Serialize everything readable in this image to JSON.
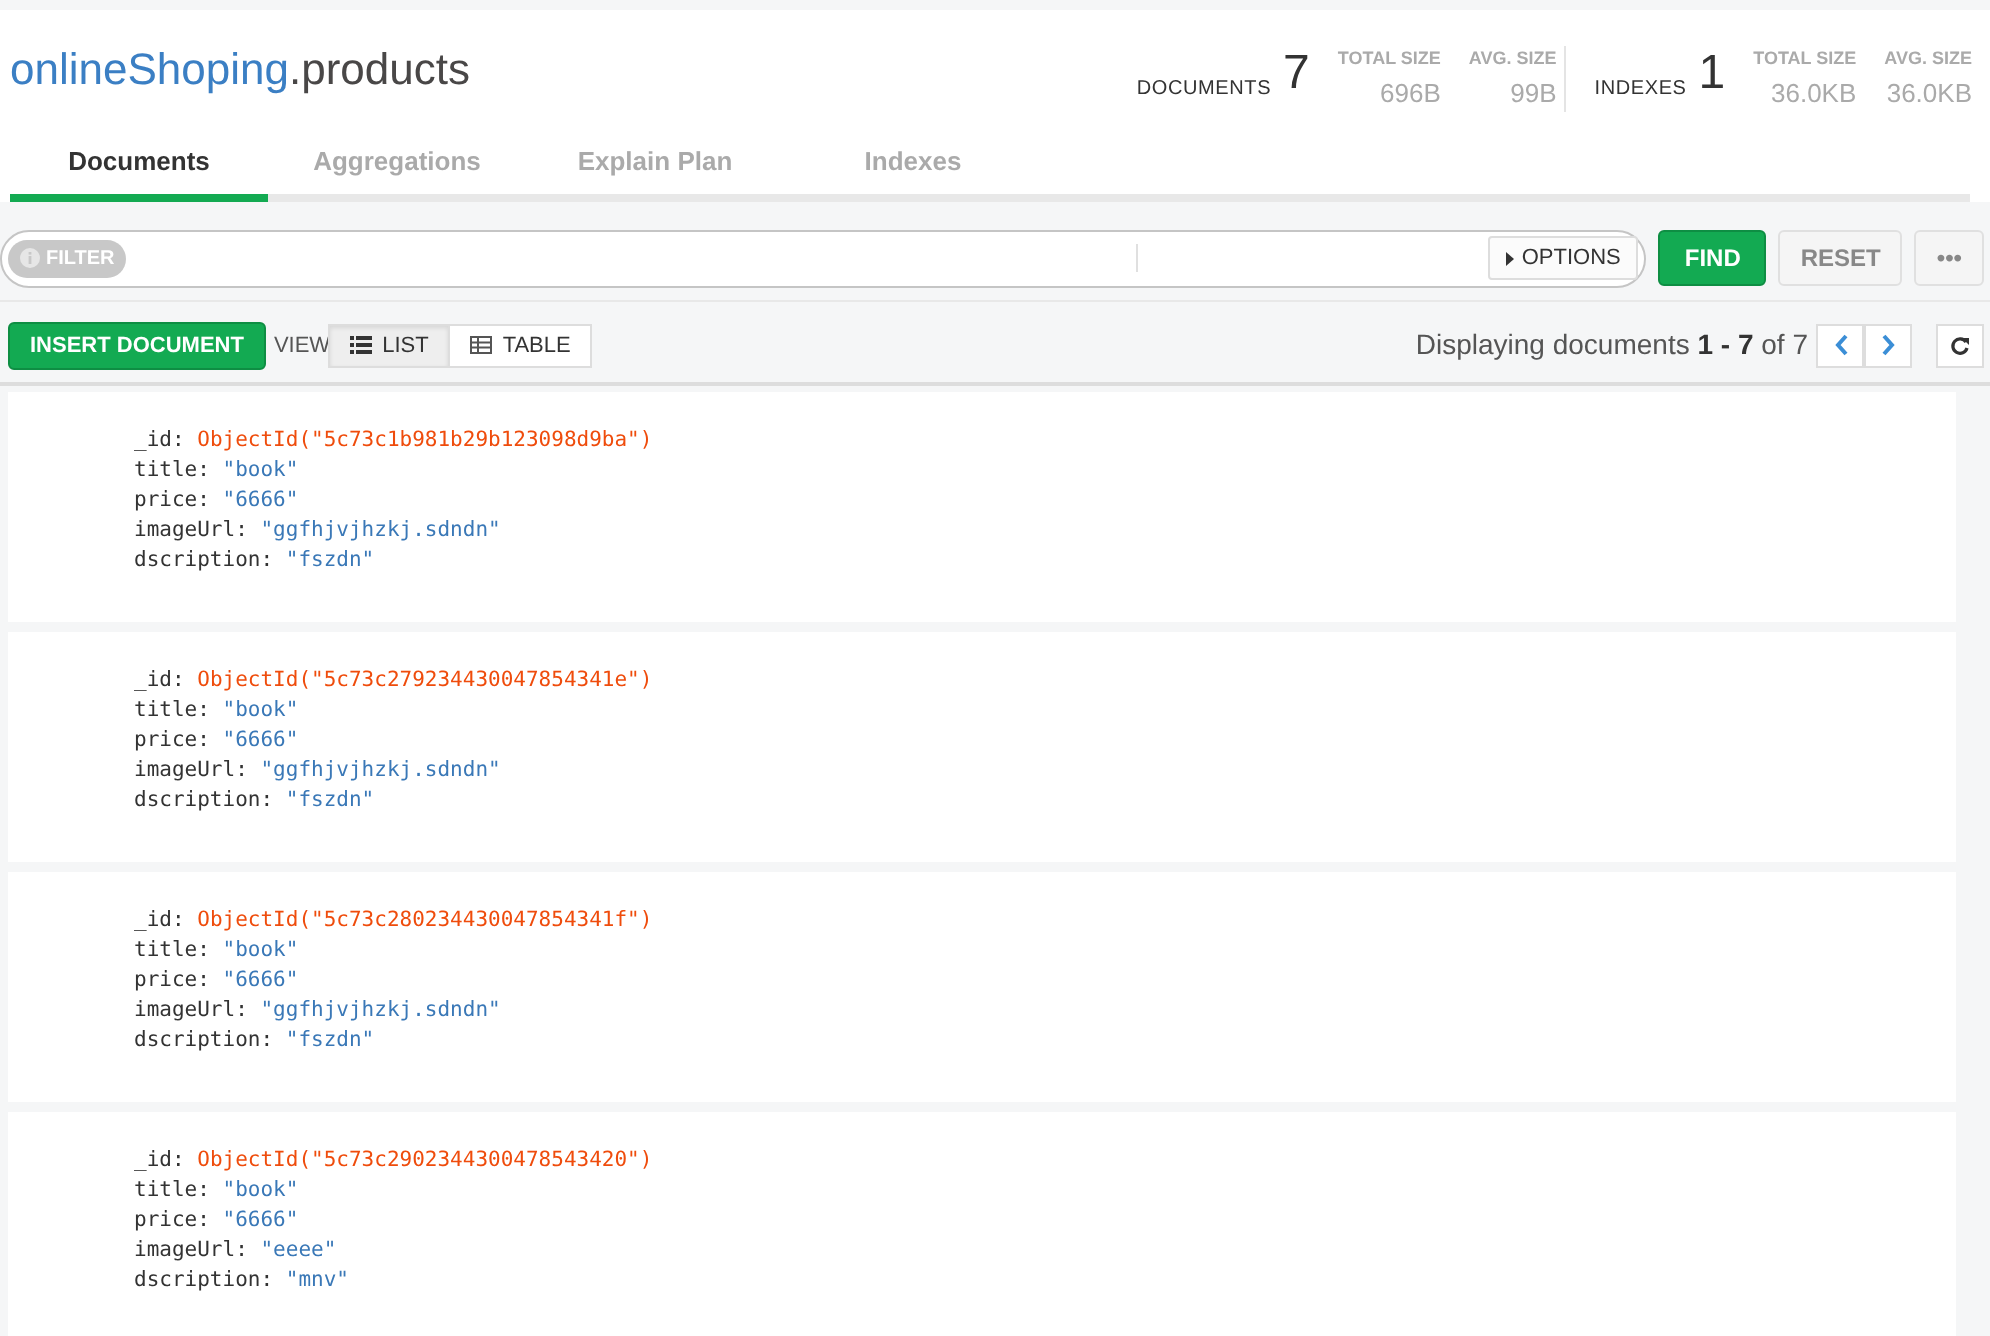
{
  "collection": {
    "database": "onlineShoping",
    "name": ".products"
  },
  "stats": {
    "documents": {
      "label": "DOCUMENTS",
      "count": "7",
      "sizes": [
        {
          "label": "TOTAL SIZE",
          "value": "696B"
        },
        {
          "label": "AVG. SIZE",
          "value": "99B"
        }
      ]
    },
    "indexes": {
      "label": "INDEXES",
      "count": "1",
      "sizes": [
        {
          "label": "TOTAL SIZE",
          "value": "36.0KB"
        },
        {
          "label": "AVG. SIZE",
          "value": "36.0KB"
        }
      ]
    }
  },
  "tabs": [
    {
      "label": "Documents",
      "selected": true
    },
    {
      "label": "Aggregations",
      "selected": false
    },
    {
      "label": "Explain Plan",
      "selected": false
    },
    {
      "label": "Indexes",
      "selected": false
    }
  ],
  "query_bar": {
    "filter_label": "FILTER",
    "options_label": "OPTIONS",
    "buttons": [
      "FIND",
      "RESET",
      "•••"
    ]
  },
  "toolbar": {
    "insert_label": "INSERT DOCUMENT",
    "view_label": "VIEW",
    "views": [
      {
        "label": "LIST",
        "selected": true
      },
      {
        "label": "TABLE",
        "selected": false
      }
    ],
    "paging": "Displaying documents **1 - 7** of 7"
  },
  "documents": [
    {
      "fields": [
        {
          "key": "_id:",
          "value": "ObjectId(\"5c73c1b981b29b123098d9ba\")",
          "kind": "objectid"
        },
        {
          "key": "title:",
          "value": "\"book\"",
          "kind": "string"
        },
        {
          "key": "price:",
          "value": "\"6666\"",
          "kind": "string"
        },
        {
          "key": "imageUrl:",
          "value": "\"ggfhjvjhzkj.sdndn\"",
          "kind": "string"
        },
        {
          "key": "dscription:",
          "value": "\"fszdn\"",
          "kind": "string"
        }
      ]
    },
    {
      "fields": [
        {
          "key": "_id:",
          "value": "ObjectId(\"5c73c279234430047854341e\")",
          "kind": "objectid"
        },
        {
          "key": "title:",
          "value": "\"book\"",
          "kind": "string"
        },
        {
          "key": "price:",
          "value": "\"6666\"",
          "kind": "string"
        },
        {
          "key": "imageUrl:",
          "value": "\"ggfhjvjhzkj.sdndn\"",
          "kind": "string"
        },
        {
          "key": "dscription:",
          "value": "\"fszdn\"",
          "kind": "string"
        }
      ]
    },
    {
      "fields": [
        {
          "key": "_id:",
          "value": "ObjectId(\"5c73c280234430047854341f\")",
          "kind": "objectid"
        },
        {
          "key": "title:",
          "value": "\"book\"",
          "kind": "string"
        },
        {
          "key": "price:",
          "value": "\"6666\"",
          "kind": "string"
        },
        {
          "key": "imageUrl:",
          "value": "\"ggfhjvjhzkj.sdndn\"",
          "kind": "string"
        },
        {
          "key": "dscription:",
          "value": "\"fszdn\"",
          "kind": "string"
        }
      ]
    },
    {
      "fields": [
        {
          "key": "_id:",
          "value": "ObjectId(\"5c73c2902344300478543420\")",
          "kind": "objectid"
        },
        {
          "key": "title:",
          "value": "\"book\"",
          "kind": "string"
        },
        {
          "key": "price:",
          "value": "\"6666\"",
          "kind": "string"
        },
        {
          "key": "imageUrl:",
          "value": "\"eeee\"",
          "kind": "string"
        },
        {
          "key": "dscription:",
          "value": "\"mnv\"",
          "kind": "string"
        }
      ]
    }
  ]
}
